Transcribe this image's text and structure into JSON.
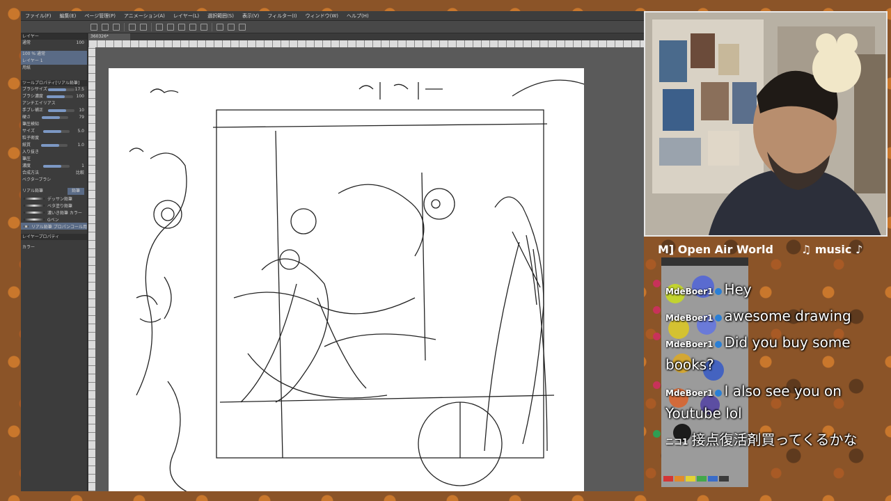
{
  "csp": {
    "menu": [
      "ファイル(F)",
      "編集(E)",
      "ページ管理(P)",
      "アニメーション(A)",
      "レイヤー(L)",
      "選択範囲(S)",
      "表示(V)",
      "フィルター(I)",
      "ウィンドウ(W)",
      "ヘルプ(H)"
    ],
    "doc_tab": "360326*",
    "layers_panel": {
      "header": "レイヤー",
      "blend_mode": "通常",
      "opacity": "100",
      "layer1_name": "100 % 通常",
      "layer1_sub": "レイヤー 1",
      "layer2_name": "用紙"
    },
    "tool_property": {
      "header": "ツールプロパティ[リアル鉛筆]",
      "rows": [
        {
          "label": "ブラシサイズ",
          "value": "17.5"
        },
        {
          "label": "ブラシ濃度",
          "value": "100"
        },
        {
          "label": "アンチエイリアス",
          "value": ""
        },
        {
          "label": "手ブレ補正",
          "value": "10"
        },
        {
          "label": "硬さ",
          "value": "79"
        },
        {
          "label": "筆圧検知",
          "value": ""
        },
        {
          "label": "サイズ",
          "value": "5.0"
        },
        {
          "label": "粒子密度",
          "value": ""
        },
        {
          "label": "紙質",
          "value": "1.0"
        },
        {
          "label": "入り抜き",
          "value": ""
        },
        {
          "label": "筆圧",
          "value": ""
        },
        {
          "label": "濃度",
          "value": "1"
        },
        {
          "label": "合成方法",
          "value": "比較"
        },
        {
          "label": "ベクターブラシ",
          "value": ""
        }
      ]
    },
    "sub_tool": {
      "tab1": "リアル鉛筆",
      "tab2": "鉛筆",
      "brushes": [
        "デッサン鉛筆",
        "ベタ塗り鉛筆",
        "濃いき鉛筆 カラー",
        "Gペン",
        "リアル鉛筆 ブロパンコール用"
      ]
    },
    "layer_property": "レイヤープロパティ",
    "color_label": "カラー"
  },
  "ticker": {
    "left": "M] Open Air World",
    "right": "♫ music ♪ h"
  },
  "chat": {
    "messages": [
      {
        "user": "MdeBoer1",
        "text": "Hey",
        "badge": "red"
      },
      {
        "user": "MdeBoer1",
        "text": "awesome drawing",
        "badge": "red"
      },
      {
        "user": "MdeBoer1",
        "text": "Did you buy some books?",
        "badge": "red"
      },
      {
        "user": "MdeBoer1",
        "text": "I also see you on Youtube lol",
        "badge": "red"
      },
      {
        "user": "ニコ1",
        "text": "接点復活剤買ってくるかな",
        "badge": "green"
      }
    ]
  },
  "colors": {
    "accent_blue": "#5a6b86",
    "badge_red": "#c8325a",
    "badge_green": "#2f9e52"
  }
}
